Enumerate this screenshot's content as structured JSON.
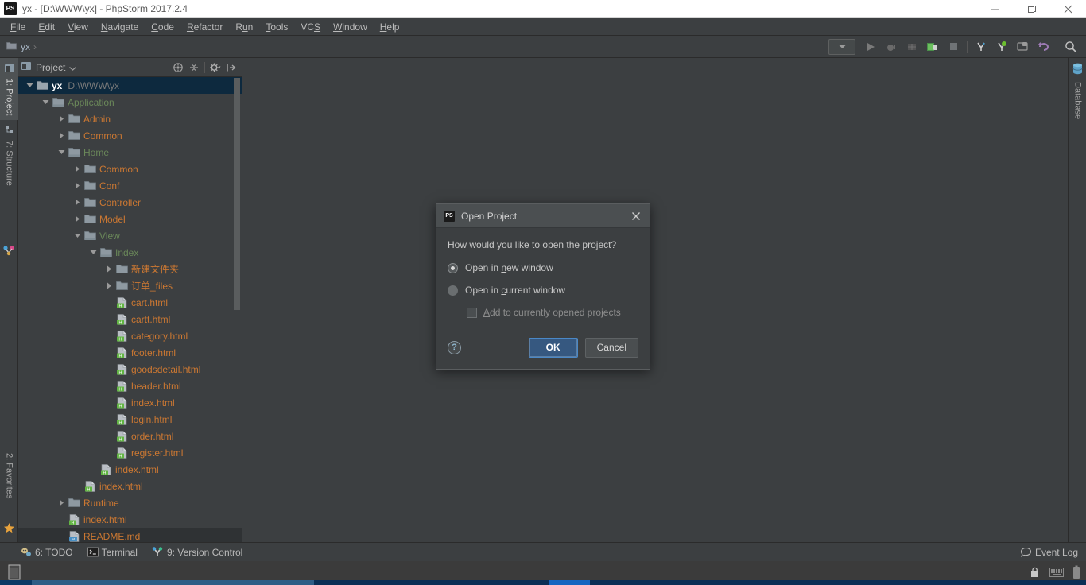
{
  "window": {
    "title": "yx - [D:\\WWW\\yx] - PhpStorm 2017.2.4",
    "app_icon": "PS",
    "controls": {
      "minimize": "minimize-icon",
      "maximize": "maximize-icon",
      "close": "close-icon"
    }
  },
  "menubar": {
    "items": [
      {
        "label": "File",
        "mnemonic": "F"
      },
      {
        "label": "Edit",
        "mnemonic": "E"
      },
      {
        "label": "View",
        "mnemonic": "V"
      },
      {
        "label": "Navigate",
        "mnemonic": "N"
      },
      {
        "label": "Code",
        "mnemonic": "C"
      },
      {
        "label": "Refactor",
        "mnemonic": "R"
      },
      {
        "label": "Run",
        "mnemonic": "u"
      },
      {
        "label": "Tools",
        "mnemonic": "T"
      },
      {
        "label": "VCS",
        "mnemonic": "S"
      },
      {
        "label": "Window",
        "mnemonic": "W"
      },
      {
        "label": "Help",
        "mnemonic": "H"
      }
    ]
  },
  "navbar": {
    "breadcrumb": "yx",
    "separator": "›",
    "run_config_placeholder": "",
    "buttons": [
      "run-configurations-dropdown",
      "run-icon",
      "debug-icon",
      "coverage-icon",
      "profile-icon",
      "stop-icon",
      "vcs-update-icon",
      "vcs-commit-icon",
      "settings-icon",
      "undo-icon",
      "search-everywhere-icon"
    ]
  },
  "left_tool_strip": {
    "tabs": [
      {
        "label": "1: Project",
        "mnemonic": "1",
        "icon": "project-icon",
        "selected": true
      },
      {
        "label": "7: Structure",
        "mnemonic": "7",
        "icon": "structure-icon",
        "selected": false
      },
      {
        "label": "2: Favorites",
        "mnemonic": "2",
        "icon": "favorites-star-icon",
        "selected": false
      }
    ]
  },
  "right_tool_strip": {
    "tabs": [
      {
        "label": "Database",
        "icon": "database-icon",
        "selected": false
      }
    ]
  },
  "project_panel": {
    "title": "Project",
    "dropdown_icon": "chevron-down-icon",
    "actions": [
      "expand-all-icon",
      "collapse-all-icon",
      "settings-gear-icon",
      "hide-icon"
    ],
    "tree": [
      {
        "depth": 0,
        "twist": "down",
        "icon": "module-folder",
        "label": "yx",
        "sub": "D:\\WWW\\yx",
        "color": "#ffffff",
        "bold": true,
        "state": "selected"
      },
      {
        "depth": 1,
        "twist": "down",
        "icon": "folder-src",
        "label": "Application",
        "color": "#6a8759"
      },
      {
        "depth": 2,
        "twist": "right",
        "icon": "folder",
        "label": "Admin",
        "color": "#cc7832"
      },
      {
        "depth": 2,
        "twist": "right",
        "icon": "folder",
        "label": "Common",
        "color": "#cc7832"
      },
      {
        "depth": 2,
        "twist": "down",
        "icon": "folder-src",
        "label": "Home",
        "color": "#6a8759"
      },
      {
        "depth": 3,
        "twist": "right",
        "icon": "folder",
        "label": "Common",
        "color": "#cc7832"
      },
      {
        "depth": 3,
        "twist": "right",
        "icon": "folder",
        "label": "Conf",
        "color": "#cc7832"
      },
      {
        "depth": 3,
        "twist": "right",
        "icon": "folder",
        "label": "Controller",
        "color": "#cc7832"
      },
      {
        "depth": 3,
        "twist": "right",
        "icon": "folder",
        "label": "Model",
        "color": "#cc7832"
      },
      {
        "depth": 3,
        "twist": "down",
        "icon": "folder-src",
        "label": "View",
        "color": "#6a8759"
      },
      {
        "depth": 4,
        "twist": "down",
        "icon": "folder-src",
        "label": "Index",
        "color": "#6a8759"
      },
      {
        "depth": 5,
        "twist": "right",
        "icon": "folder",
        "label": "新建文件夹",
        "color": "#cc7832"
      },
      {
        "depth": 5,
        "twist": "right",
        "icon": "folder",
        "label": "订单_files",
        "color": "#cc7832"
      },
      {
        "depth": 5,
        "twist": "none",
        "icon": "html-file",
        "label": "cart.html",
        "color": "#cc7832"
      },
      {
        "depth": 5,
        "twist": "none",
        "icon": "html-file",
        "label": "cartt.html",
        "color": "#cc7832"
      },
      {
        "depth": 5,
        "twist": "none",
        "icon": "html-file",
        "label": "category.html",
        "color": "#cc7832"
      },
      {
        "depth": 5,
        "twist": "none",
        "icon": "html-file",
        "label": "footer.html",
        "color": "#cc7832"
      },
      {
        "depth": 5,
        "twist": "none",
        "icon": "html-file",
        "label": "goodsdetail.html",
        "color": "#cc7832"
      },
      {
        "depth": 5,
        "twist": "none",
        "icon": "html-file",
        "label": "header.html",
        "color": "#cc7832"
      },
      {
        "depth": 5,
        "twist": "none",
        "icon": "html-file",
        "label": "index.html",
        "color": "#cc7832"
      },
      {
        "depth": 5,
        "twist": "none",
        "icon": "html-file",
        "label": "login.html",
        "color": "#cc7832"
      },
      {
        "depth": 5,
        "twist": "none",
        "icon": "html-file",
        "label": "order.html",
        "color": "#cc7832"
      },
      {
        "depth": 5,
        "twist": "none",
        "icon": "html-file",
        "label": "register.html",
        "color": "#cc7832"
      },
      {
        "depth": 4,
        "twist": "none",
        "icon": "html-file",
        "label": "index.html",
        "color": "#cc7832"
      },
      {
        "depth": 3,
        "twist": "none",
        "icon": "html-file",
        "label": "index.html",
        "color": "#cc7832"
      },
      {
        "depth": 2,
        "twist": "right",
        "icon": "folder",
        "label": "Runtime",
        "color": "#cc7832"
      },
      {
        "depth": 2,
        "twist": "none",
        "icon": "html-file",
        "label": "index.html",
        "color": "#cc7832"
      },
      {
        "depth": 2,
        "twist": "none",
        "icon": "md-file",
        "label": "README.md",
        "color": "#cc7832",
        "state": "focus-last"
      }
    ]
  },
  "dialog": {
    "icon": "PS",
    "title": "Open Project",
    "close_icon": "close-icon",
    "question": "How would you like to open the project?",
    "options": [
      {
        "label_pre": "Open in ",
        "mnemonic": "n",
        "label_post": "ew window",
        "selected": true
      },
      {
        "label_pre": "Open in ",
        "mnemonic": "c",
        "label_post": "urrent window",
        "selected": false
      }
    ],
    "checkbox": {
      "label_pre": "",
      "mnemonic": "A",
      "label_post": "dd to currently opened projects",
      "checked": false,
      "enabled": false
    },
    "help_label": "?",
    "ok_label": "OK",
    "cancel_label": "Cancel",
    "accent": "#365880"
  },
  "statusbar": {
    "items": [
      {
        "label": "6: TODO",
        "mnemonic": "6",
        "icon": "todo-icon"
      },
      {
        "label": "Terminal",
        "mnemonic": "",
        "icon": "terminal-icon"
      },
      {
        "label": "9: Version Control",
        "mnemonic": "9",
        "icon": "vcs-icon"
      }
    ],
    "right": {
      "label": "Event Log",
      "icon": "event-log-icon"
    }
  },
  "os_taskbar": {
    "items": [
      "window-thumb-icon"
    ],
    "tray": [
      "lock-icon",
      "keyboard-icon",
      "battery-icon"
    ],
    "clock": ""
  }
}
